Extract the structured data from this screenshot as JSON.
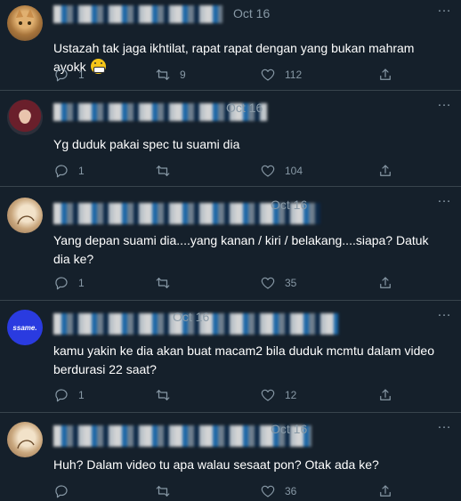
{
  "colors": {
    "background": "#15202b",
    "divider": "#38444d",
    "muted": "#8899a6",
    "text": "#ffffff"
  },
  "more_icon": "…",
  "tweets": [
    {
      "timestamp": "Oct 16",
      "avatar": "cat-photo-avatar",
      "text": "Ustazah tak jaga ikhtilat, rapat rapat dengan yang bukan mahram ayokk",
      "emoji": "grimacing-face",
      "replies": "1",
      "retweets": "9",
      "likes": "112"
    },
    {
      "timestamp": "Oct 16",
      "avatar": "hijab-woman-avatar",
      "text": "Yg duduk pakai spec tu suami dia",
      "replies": "1",
      "retweets": "",
      "likes": "104"
    },
    {
      "timestamp": "Oct 16",
      "avatar": "sketch-portrait-avatar",
      "text": "Yang depan suami dia....yang kanan / kiri / belakang....siapa? Datuk dia ke?",
      "replies": "1",
      "retweets": "",
      "likes": "35"
    },
    {
      "timestamp": "Oct 16",
      "avatar": "blue-logo-avatar",
      "avatar_text": "ssame.",
      "text": "kamu yakin ke dia akan buat macam2 bila duduk mcmtu dalam video berdurasi 22 saat?",
      "replies": "1",
      "retweets": "",
      "likes": "12"
    },
    {
      "timestamp": "Oct 16",
      "avatar": "sketch-portrait-avatar",
      "text": "Huh? Dalam video tu apa walau sesaat pon? Otak ada ke?",
      "replies": "",
      "retweets": "",
      "likes": "36"
    }
  ]
}
